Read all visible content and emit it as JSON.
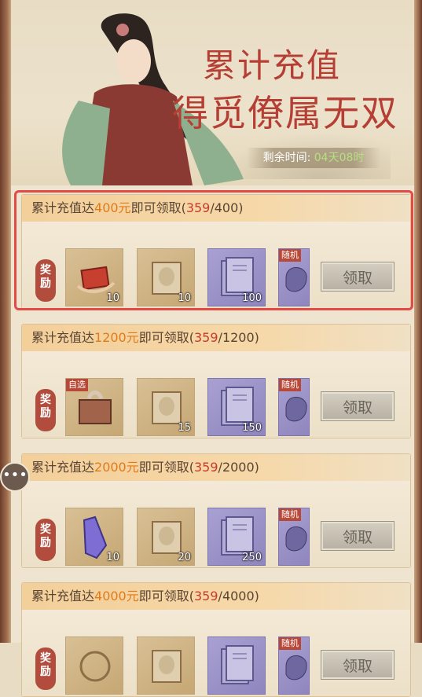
{
  "banner": {
    "title_line1": "累计充值",
    "title_line2": "得觅僚属无双",
    "timer_label": "剩余时间:",
    "timer_value": "04天08时"
  },
  "tiers": [
    {
      "prefix": "累计充值达",
      "amount": "400元",
      "suffix": "即可领取(",
      "current": "359",
      "target": "/400)",
      "badge": "奖励",
      "claim_label": "领取",
      "items": [
        {
          "icon": "red-silk-icon",
          "qty": "10",
          "tag": ""
        },
        {
          "icon": "scroll-icon",
          "qty": "10",
          "tag": ""
        },
        {
          "icon": "book-icon",
          "qty": "100",
          "tag": ""
        },
        {
          "icon": "random-bag-icon",
          "qty": "",
          "tag": "随机"
        }
      ]
    },
    {
      "prefix": "累计充值达",
      "amount": "1200元",
      "suffix": "即可领取(",
      "current": "359",
      "target": "/1200)",
      "badge": "奖励",
      "claim_label": "领取",
      "items": [
        {
          "icon": "gift-box-icon",
          "qty": "",
          "tag": "自选"
        },
        {
          "icon": "scroll-icon",
          "qty": "15",
          "tag": ""
        },
        {
          "icon": "book-icon",
          "qty": "150",
          "tag": ""
        },
        {
          "icon": "random-bag-icon",
          "qty": "",
          "tag": "随机"
        }
      ]
    },
    {
      "prefix": "累计充值达",
      "amount": "2000元",
      "suffix": "即可领取(",
      "current": "359",
      "target": "/2000)",
      "badge": "奖励",
      "claim_label": "领取",
      "items": [
        {
          "icon": "purple-crystal-icon",
          "qty": "10",
          "tag": ""
        },
        {
          "icon": "scroll-icon",
          "qty": "20",
          "tag": ""
        },
        {
          "icon": "book-icon",
          "qty": "250",
          "tag": ""
        },
        {
          "icon": "random-bag-icon",
          "qty": "",
          "tag": "随机"
        }
      ]
    },
    {
      "prefix": "累计充值达",
      "amount": "4000元",
      "suffix": "即可领取(",
      "current": "359",
      "target": "/4000)",
      "badge": "奖励",
      "claim_label": "领取",
      "items": [
        {
          "icon": "token-icon",
          "qty": "",
          "tag": ""
        },
        {
          "icon": "scroll-icon",
          "qty": "",
          "tag": ""
        },
        {
          "icon": "book-icon",
          "qty": "",
          "tag": ""
        },
        {
          "icon": "random-bag-icon",
          "qty": "",
          "tag": "随机"
        }
      ]
    }
  ],
  "side": {
    "chat_icon": "chat-bubble-icon"
  }
}
